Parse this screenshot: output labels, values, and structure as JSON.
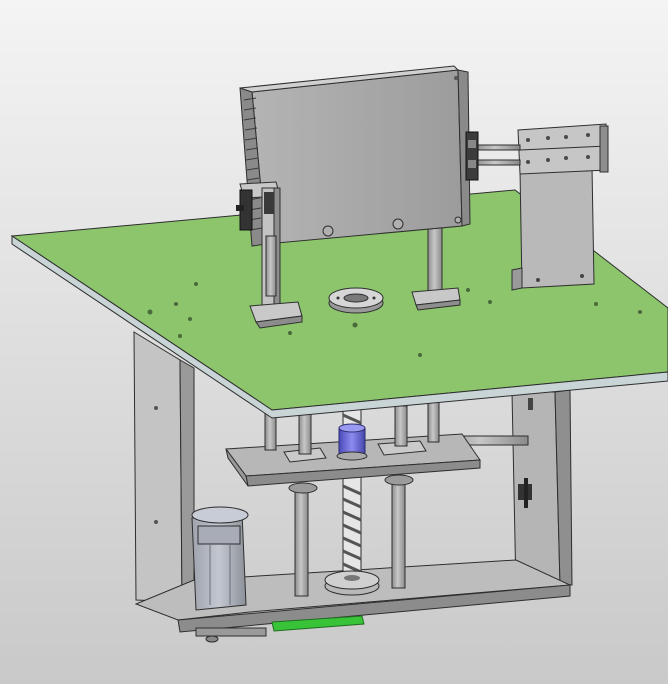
{
  "scene": {
    "subject": "cad-model-lift-fixture",
    "colors": {
      "background_top": "#f4f4f4",
      "background_bottom": "#c9c9c9",
      "table_top": "#8cc56c",
      "table_edge": "#c9d4d6",
      "steel": "#a6a6a6",
      "steel_dark": "#7c7c7c",
      "outline": "#2e2e2e",
      "bearing_blue": "#6e6ed8",
      "rail_green": "#39c339"
    }
  }
}
